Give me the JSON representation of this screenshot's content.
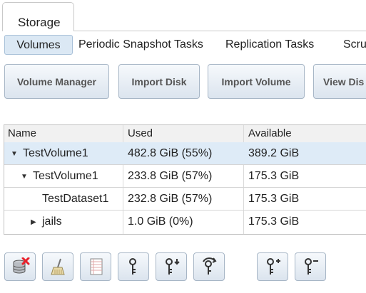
{
  "top_tab": {
    "label": "Storage"
  },
  "subtabs": [
    {
      "label": "Volumes",
      "active": true
    },
    {
      "label": "Periodic Snapshot Tasks"
    },
    {
      "label": "Replication Tasks"
    },
    {
      "label": "Scru"
    }
  ],
  "toolbar": {
    "volume_manager": "Volume Manager",
    "import_disk": "Import Disk",
    "import_volume": "Import Volume",
    "view_disks": "View Dis"
  },
  "table": {
    "headers": {
      "name": "Name",
      "used": "Used",
      "available": "Available"
    },
    "rows": [
      {
        "name": "TestVolume1",
        "used": "482.8 GiB (55%)",
        "available": "389.2 GiB",
        "level": 0,
        "expanded": true
      },
      {
        "name": "TestVolume1",
        "used": "233.8 GiB (57%)",
        "available": "175.3 GiB",
        "level": 1,
        "expanded": true
      },
      {
        "name": "TestDataset1",
        "used": "232.8 GiB (57%)",
        "available": "175.3 GiB",
        "level": 2
      },
      {
        "name": "jails",
        "used": "1.0 GiB (0%)",
        "available": "175.3 GiB",
        "level": 2,
        "expanded": false
      }
    ]
  },
  "bottom_actions": [
    {
      "icon": "detach-volume-icon"
    },
    {
      "icon": "scrub-broom-icon"
    },
    {
      "icon": "volume-status-icon"
    },
    {
      "icon": "key-icon"
    },
    {
      "icon": "download-key-icon"
    },
    {
      "icon": "change-passphrase-icon"
    },
    {
      "icon": "add-recovery-key-icon"
    },
    {
      "icon": "remove-recovery-key-icon"
    }
  ],
  "colors": {
    "accent_delete": "#e8202a",
    "selected_row": "#deebf7"
  }
}
